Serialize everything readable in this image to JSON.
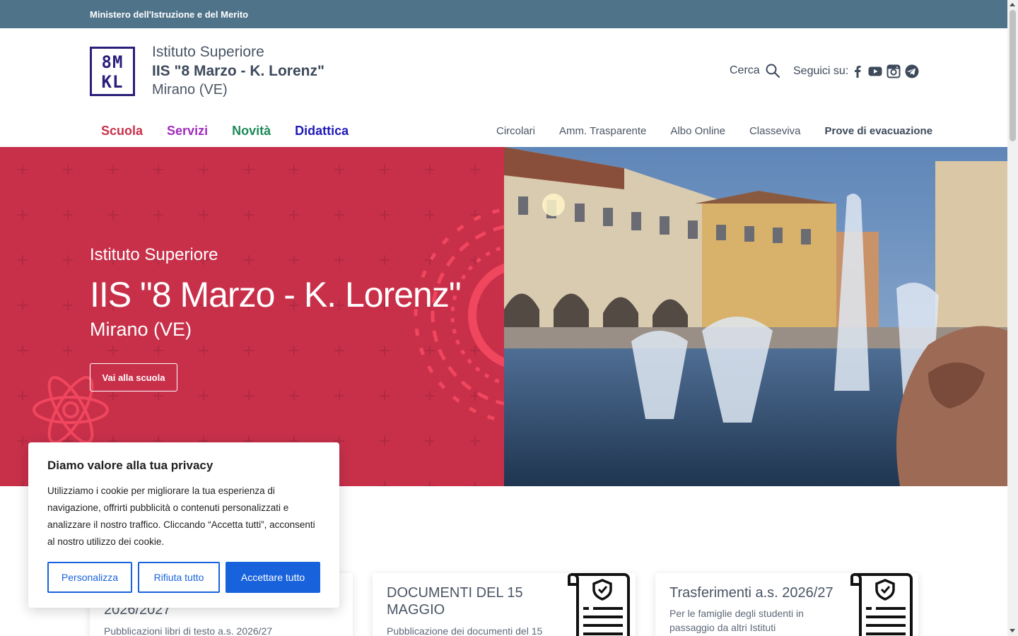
{
  "topbar": {
    "text": "Ministero dell'Istruzione e del Merito"
  },
  "header": {
    "logo_row1": "8M",
    "logo_row2": "KL",
    "subtitle": "Istituto Superiore",
    "name": "IIS \"8 Marzo - K. Lorenz\"",
    "city": "Mirano (VE)",
    "search_label": "Cerca",
    "follow_label": "Seguici su:",
    "socials": [
      "facebook-icon",
      "youtube-icon",
      "instagram-icon",
      "telegram-icon"
    ]
  },
  "nav_main": [
    {
      "label": "Scuola",
      "color": "#c8304a"
    },
    {
      "label": "Servizi",
      "color": "#a02dbd"
    },
    {
      "label": "Novità",
      "color": "#1e8a5a"
    },
    {
      "label": "Didattica",
      "color": "#1f1ab8"
    }
  ],
  "nav_secondary": [
    "Circolari",
    "Amm. Trasparente",
    "Albo Online",
    "Classeviva",
    "Prove di evacuazione"
  ],
  "hero": {
    "subtitle": "Istituto Superiore",
    "title": "IIS \"8 Marzo - K. Lorenz\"",
    "city": "Mirano (VE)",
    "button": "Vai alla scuola",
    "accent": "#c8304a"
  },
  "cards": [
    {
      "title": "2026/2027",
      "desc": "Pubblicazioni libri di testo a.s. 2026/27"
    },
    {
      "title": "DOCUMENTI DEL 15 MAGGIO",
      "desc": "Pubblicazione dei documenti del 15"
    },
    {
      "title": "Trasferimenti a.s. 2026/27",
      "desc": "Per le famiglie degli studenti in passaggio da altri Istituti"
    }
  ],
  "cookie": {
    "title": "Diamo valore alla tua privacy",
    "text": "Utilizziamo i cookie per migliorare la tua esperienza di navigazione, offrirti pubblicità o contenuti personalizzati e analizzare il nostro traffico. Cliccando “Accetta tutti”, acconsenti al nostro utilizzo dei cookie.",
    "customize": "Personalizza",
    "reject": "Rifiuta tutto",
    "accept": "Accettare tutto",
    "accent": "#1863dc"
  }
}
